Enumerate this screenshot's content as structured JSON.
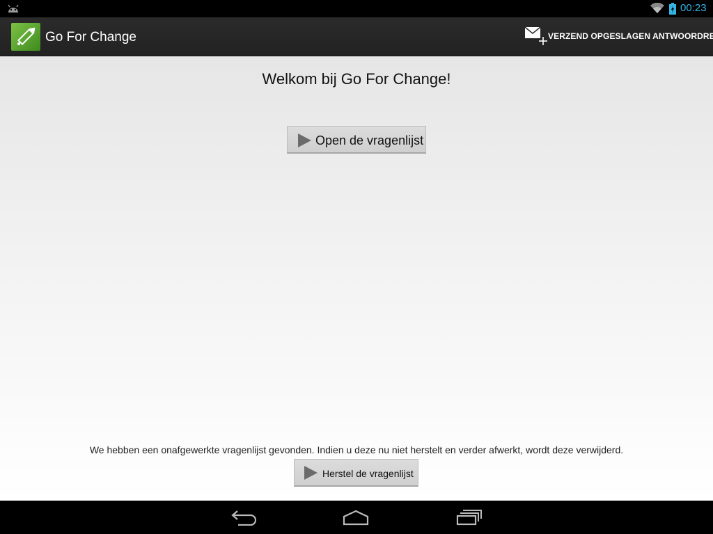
{
  "status_bar": {
    "time": "00:23",
    "time_color": "#33b5e5",
    "icons": [
      "android-debug-icon",
      "wifi-icon",
      "battery-charging-icon"
    ]
  },
  "action_bar": {
    "app_icon": "pencil-logo-icon",
    "title": "Go For Change",
    "send_action": {
      "icon": "mail-add-icon",
      "label": "VERZEND OPGESLAGEN ANTWOORDREEKSEN"
    }
  },
  "main": {
    "welcome": "Welkom bij Go For Change!",
    "open_button": {
      "icon": "play-icon",
      "label": "Open de vragenlijst"
    },
    "notice": "We hebben een onafgewerkte vragenlijst gevonden. Indien u deze nu niet herstelt en verder afwerkt, wordt deze verwijderd.",
    "restore_button": {
      "icon": "play-icon",
      "label": "Herstel de vragenlijst"
    }
  },
  "nav_bar": {
    "buttons": [
      "back-icon",
      "home-icon",
      "recents-icon"
    ]
  }
}
